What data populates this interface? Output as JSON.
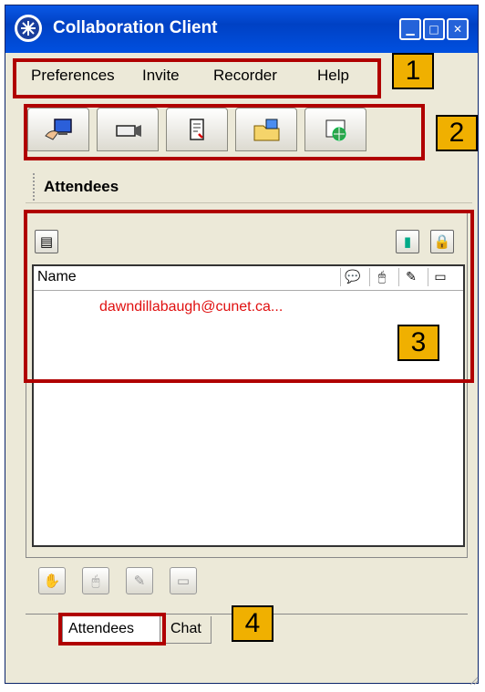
{
  "window": {
    "title": "Collaboration Client",
    "controls": {
      "minimize": "▁",
      "maximize": "□",
      "close": "✕"
    }
  },
  "menu": {
    "items": [
      "Preferences",
      "Invite",
      "Recorder",
      "Help"
    ]
  },
  "toolbar": {
    "buttons": [
      "share-desktop-icon",
      "camera-icon",
      "document-icon",
      "folder-transfer-icon",
      "web-browser-icon"
    ]
  },
  "section": {
    "title": "Attendees"
  },
  "attendees_panel": {
    "column_name": "Name",
    "column_icons": [
      "chat-icon",
      "mouse-icon",
      "pencil-icon",
      "video-icon"
    ],
    "rows": [
      "dawndillabaugh@cunet.ca..."
    ]
  },
  "tabs": {
    "attendees": "Attendees",
    "chat": "Chat"
  },
  "callouts": [
    "1",
    "2",
    "3",
    "4"
  ],
  "colors": {
    "highlight": "#b00000",
    "badge": "#f0b000",
    "attendee_text": "#e01010",
    "titlebar": "#0050e0"
  }
}
